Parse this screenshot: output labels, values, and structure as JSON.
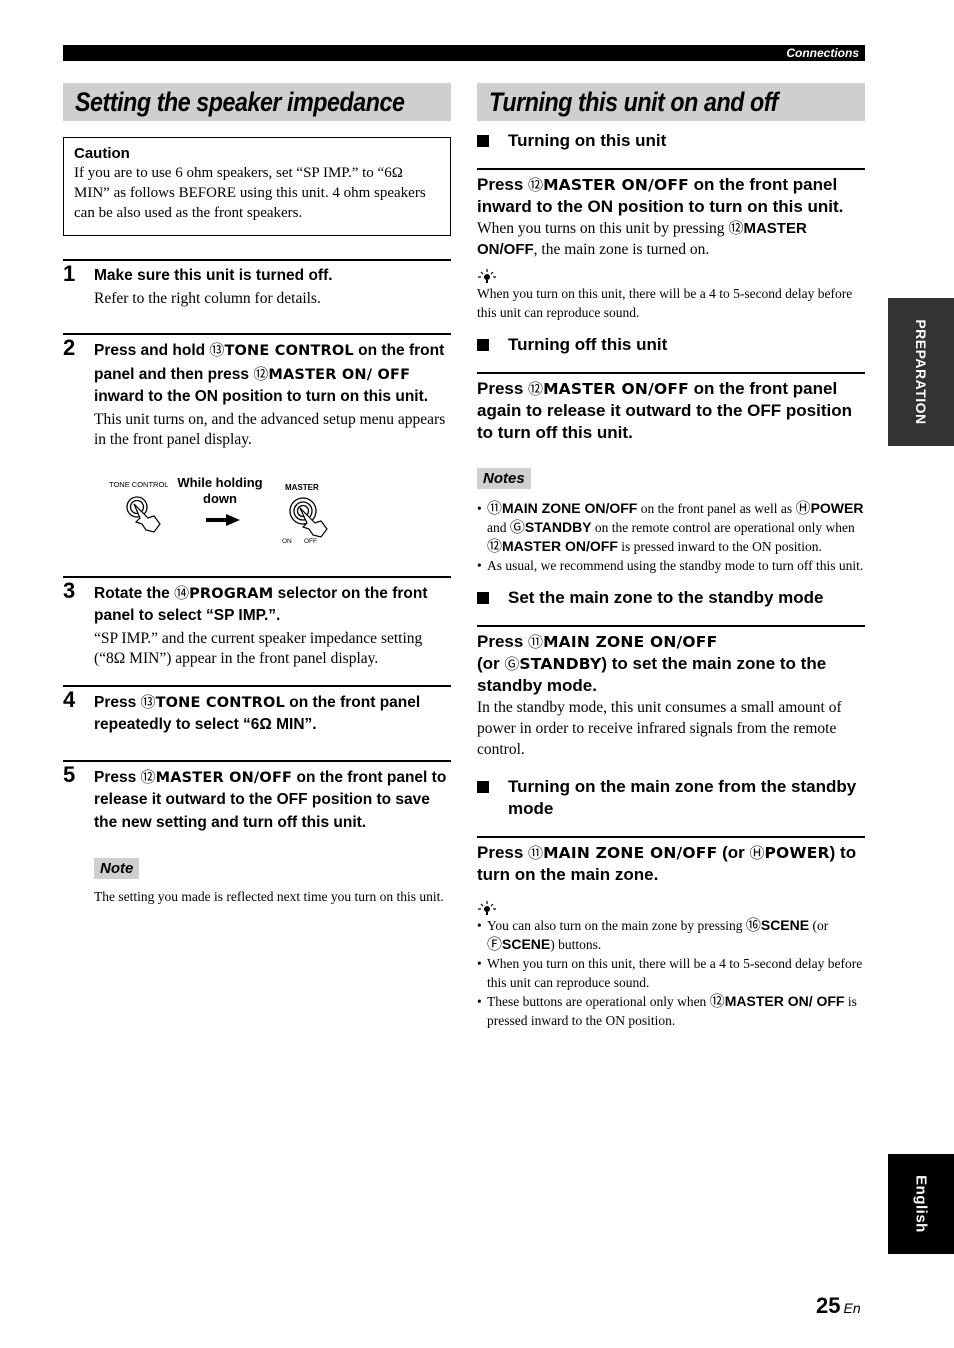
{
  "header": {
    "section": "Connections"
  },
  "left": {
    "title": "Setting the speaker impedance",
    "caution": {
      "heading": "Caution",
      "text": "If you are to use 6 ohm speakers, set “SP IMP.” to “6Ω MIN” as follows BEFORE using this unit. 4 ohm speakers can be also used as the front speakers."
    },
    "steps": [
      {
        "number": "1",
        "instruction": [
          "Make sure this unit is turned off."
        ],
        "description": "Refer to the right column for details."
      },
      {
        "number": "2",
        "instruction_parts": {
          "a": "Press and hold ",
          "c1": "⑬",
          "k1": "TONE CONTROL",
          "b": " on the front panel and then press ",
          "c2": "⑫",
          "k2": "MASTER ON/ OFF",
          "d": " inward to the ON position to turn on this unit."
        },
        "description": "This unit turns on, and the advanced setup menu appears in the front panel display."
      },
      {
        "number": "3",
        "instruction_parts": {
          "a": "Rotate the ",
          "c1": "⑭",
          "k1": "PROGRAM",
          "b": " selector on the front panel to select “SP IMP.”."
        },
        "description": "“SP IMP.” and the current speaker impedance setting (“8Ω MIN”) appear in the front panel display."
      },
      {
        "number": "4",
        "instruction_parts": {
          "a": "Press ",
          "c1": "⑬",
          "k1": "TONE CONTROL",
          "b": " on the front panel repeatedly to select “6Ω MIN”."
        }
      },
      {
        "number": "5",
        "instruction_parts": {
          "a": "Press ",
          "c1": "⑫",
          "k1": "MASTER ON/OFF",
          "b": " on the front panel to release it outward to the OFF position to save the new setting and turn off this unit."
        }
      }
    ],
    "illustration": {
      "left_label": "TONE CONTROL",
      "center_label": "While holding down",
      "right_label": "MASTER",
      "switch_on": "ON",
      "switch_off": "OFF"
    },
    "note": {
      "label": "Note",
      "text": "The setting you made is reflected next time you turn on this unit."
    }
  },
  "right": {
    "title": "Turning this unit on and off",
    "turning_on": {
      "heading": "Turning on this unit",
      "press": {
        "a": "Press ",
        "c": "⑫",
        "k": "MASTER ON/OFF",
        "b": " on the front panel inward to the ON position to turn on this unit."
      },
      "desc": {
        "a": "When you turns on this unit by pressing ",
        "c": "⑫",
        "k": "MASTER ON/OFF",
        "b": ", the main zone is turned on."
      },
      "hint": "When you turn on this unit, there will be a 4 to 5-second delay before this unit can reproduce sound."
    },
    "turning_off": {
      "heading": "Turning off this unit",
      "press": {
        "a": "Press ",
        "c": "⑫",
        "k": "MASTER ON/OFF",
        "b": " on the front panel again to release it outward to the OFF position to turn off this unit."
      },
      "notes_label": "Notes",
      "notes": [
        {
          "c1": "⑪",
          "k1": "MAIN ZONE ON/OFF",
          "t1": " on the front panel as well as ",
          "c2": "Ⓗ",
          "k2": "POWER",
          "t2": " and ",
          "c3": "Ⓖ",
          "k3": "STANDBY",
          "t3": " on the remote control are operational only when ",
          "c4": "⑫",
          "k4": "MASTER ON/OFF",
          "t4": " is pressed inward to the ON position."
        },
        {
          "text": "As usual, we recommend using the standby mode to turn off this unit."
        }
      ]
    },
    "standby": {
      "heading": "Set the main zone to the standby mode",
      "press": {
        "a": "Press ",
        "c1": "⑪",
        "k1": "MAIN ZONE ON/OFF",
        "b": "(or ",
        "c2": "Ⓖ",
        "k2": "STANDBY",
        "d": ") to set the main zone to the standby mode."
      },
      "desc": "In the standby mode, this unit consumes a small amount of power in order to receive infrared signals from the remote control."
    },
    "from_standby": {
      "heading": "Turning on the main zone from the standby mode",
      "press": {
        "a": "Press ",
        "c1": "⑪",
        "k1": "MAIN ZONE ON/OFF",
        "b": " (or ",
        "c2": "Ⓗ",
        "k2": "POWER",
        "d": ") to turn on the main zone."
      },
      "hints": [
        {
          "a": "You can also turn on the main zone by pressing ",
          "c1": "⑯",
          "k1": "SCENE",
          "b": " (or ",
          "c2": "Ⓕ",
          "k2": "SCENE",
          "d": ") buttons."
        },
        {
          "text": "When you turn on this unit, there will be a 4 to 5-second delay before this unit can reproduce sound."
        },
        {
          "a": "These buttons are operational only when ",
          "c1": "⑫",
          "k1": "MASTER ON/ OFF",
          "b": " is pressed inward to the ON position."
        }
      ]
    }
  },
  "side_tabs": {
    "preparation": "PREPARATION",
    "language": "English"
  },
  "footer": {
    "page_number": "25",
    "page_suffix": "En"
  }
}
